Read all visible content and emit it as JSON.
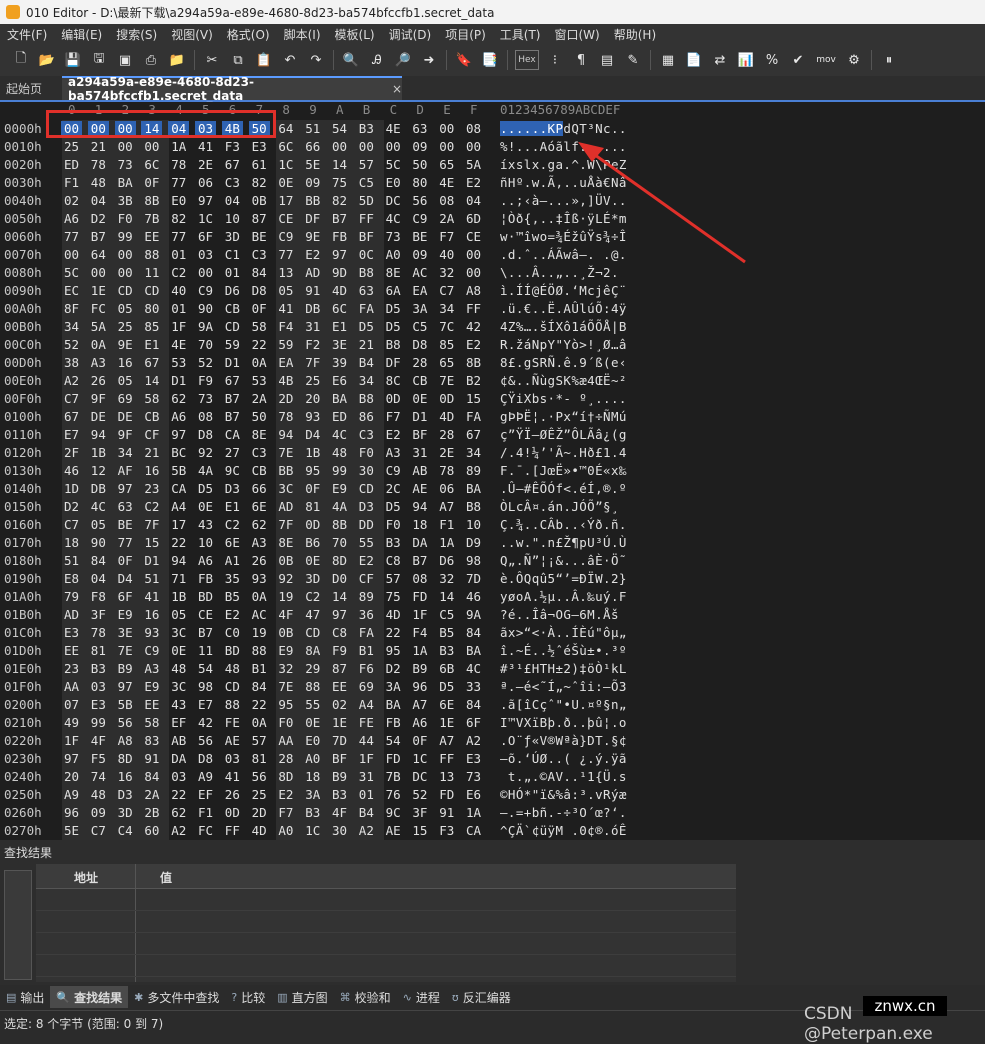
{
  "window": {
    "title": "010 Editor - D:\\最新下载\\a294a59a-e89e-4680-8d23-ba574bfccfb1.secret_data"
  },
  "menu": [
    "文件(F)",
    "编辑(E)",
    "搜索(S)",
    "视图(V)",
    "格式(O)",
    "脚本(I)",
    "模板(L)",
    "调试(D)",
    "项目(P)",
    "工具(T)",
    "窗口(W)",
    "帮助(H)"
  ],
  "toolbar": {
    "hex_label": "Hex",
    "mov_label": "mov"
  },
  "tabs": {
    "home": "起始页",
    "file": "a294a59a-e89e-4680-8d23-ba574bfccfb1.secret_data",
    "close": "×"
  },
  "hex": {
    "column_headers": [
      "0",
      "1",
      "2",
      "3",
      "4",
      "5",
      "6",
      "7",
      "8",
      "9",
      "A",
      "B",
      "C",
      "D",
      "E",
      "F"
    ],
    "ascii_header": "0123456789ABCDEF",
    "rows": [
      {
        "addr": "0000h",
        "bytes": "00 00 00 14 04 03 4B 50 64 51 54 B3 4E 63 00 08",
        "ascii": "......KPdQT³Nc.."
      },
      {
        "addr": "0010h",
        "bytes": "25 21 00 00 1A 41 F3 E3 6C 66 00 00 00 09 00 00",
        "ascii": "%!...Aóãlf......"
      },
      {
        "addr": "0020h",
        "bytes": "ED 78 73 6C 78 2E 67 61 1C 5E 14 57 5C 50 65 5A",
        "ascii": "íxslx.ga.^.W\\PeZ"
      },
      {
        "addr": "0030h",
        "bytes": "F1 48 BA 0F 77 06 C3 82 0E 09 75 C5 E0 80 4E E2",
        "ascii": "ñHº.w.Ã‚..uÅà€Nâ"
      },
      {
        "addr": "0040h",
        "bytes": "02 04 3B 8B E0 97 04 0B 17 BB 82 5D DC 56 08 04",
        "ascii": "..;‹à—...»‚]ÜV.."
      },
      {
        "addr": "0050h",
        "bytes": "A6 D2 F0 7B 82 1C 10 87 CE DF B7 FF 4C C9 2A 6D",
        "ascii": "¦Òð{‚..‡Îß·ÿLÉ*m"
      },
      {
        "addr": "0060h",
        "bytes": "77 B7 99 EE 77 6F 3D BE C9 9E FB BF 73 BE F7 CE",
        "ascii": "w·™îwo=¾ÉžûŸs¾÷Î"
      },
      {
        "addr": "0070h",
        "bytes": "00 64 00 88 01 03 C1 C3 77 E2 97 0C A0 09 40 00",
        "ascii": ".d.ˆ..ÁÃwâ—. .@."
      },
      {
        "addr": "0080h",
        "bytes": "5C 00 00 11 C2 00 01 84 13 AD 9D B8 8E AC 32 00",
        "ascii": "\\...Â..„.­.¸Ž¬2."
      },
      {
        "addr": "0090h",
        "bytes": "EC 1E CD CD 40 C9 D6 D8 05 91 4D 63 6A EA C7 A8",
        "ascii": "ì.ÍÍ@ÉÖØ.‘McjêÇ¨"
      },
      {
        "addr": "00A0h",
        "bytes": "8F FC 05 80 01 90 CB 0F 41 DB 6C FA D5 3A 34 FF",
        "ascii": ".ü.€..Ë.AÛlúÕ:4ÿ"
      },
      {
        "addr": "00B0h",
        "bytes": "34 5A 25 85 1F 9A CD 58 F4 31 E1 D5 D5 C5 7C 42",
        "ascii": "4Z%….šÍXô1áÕÕÅ|B"
      },
      {
        "addr": "00C0h",
        "bytes": "52 0A 9E E1 4E 70 59 22 59 F2 3E 21 B8 D8 85 E2",
        "ascii": "R.žáNpY\"Yò>!¸Ø…â"
      },
      {
        "addr": "00D0h",
        "bytes": "38 A3 16 67 53 52 D1 0A EA 7F 39 B4 DF 28 65 8B",
        "ascii": "8£.gSRÑ.ê.9´ß(e‹"
      },
      {
        "addr": "00E0h",
        "bytes": "A2 26 05 14 D1 F9 67 53 4B 25 E6 34 8C CB 7E B2",
        "ascii": "¢&..ÑùgSK%æ4ŒË~²"
      },
      {
        "addr": "00F0h",
        "bytes": "C7 9F 69 58 62 73 B7 2A 2D 20 BA B8 0D 0E 0D 15",
        "ascii": "ÇŸiXbs·*- º¸...."
      },
      {
        "addr": "0100h",
        "bytes": "67 DE DE CB A6 08 B7 50 78 93 ED 86 F7 D1 4D FA",
        "ascii": "gÞÞË¦.·Px“í†÷ÑMú"
      },
      {
        "addr": "0110h",
        "bytes": "E7 94 9F CF 97 D8 CA 8E 94 D4 4C C3 E2 BF 28 67",
        "ascii": "ç”ŸÏ—ØÊŽ”ÔLÃâ¿(g"
      },
      {
        "addr": "0120h",
        "bytes": "2F 1B 34 21 BC 92 27 C3 7E 1B 48 F0 A3 31 2E 34",
        "ascii": "/.4!¼’'Ã~.Hð£1.4"
      },
      {
        "addr": "0130h",
        "bytes": "46 12 AF 16 5B 4A 9C CB BB 95 99 30 C9 AB 78 89",
        "ascii": "F.¯.[JœË»•™0É«x‰"
      },
      {
        "addr": "0140h",
        "bytes": "1D DB 97 23 CA D5 D3 66 3C 0F E9 CD 2C AE 06 BA",
        "ascii": ".Û—#ÊÕÓf<.éÍ,®.º"
      },
      {
        "addr": "0150h",
        "bytes": "D2 4C 63 C2 A4 0E E1 6E AD 81 4A D3 D5 94 A7 B8",
        "ascii": "ÒLcÂ¤.án­.JÓÕ”§¸"
      },
      {
        "addr": "0160h",
        "bytes": "C7 05 BE 7F 17 43 C2 62 7F 0D 8B DD F0 18 F1 10",
        "ascii": "Ç.¾..CÂb..‹Ýð.ñ."
      },
      {
        "addr": "0170h",
        "bytes": "18 90 77 15 22 10 6E A3 8E B6 70 55 B3 DA 1A D9",
        "ascii": "..w.\".n£Ž¶pU³Ú.Ù"
      },
      {
        "addr": "0180h",
        "bytes": "51 84 0F D1 94 A6 A1 26 0B 0E 8D E2 C8 B7 D6 98",
        "ascii": "Q„.Ñ”¦¡&...âÈ·Ö˜"
      },
      {
        "addr": "0190h",
        "bytes": "E8 04 D4 51 71 FB 35 93 92 3D D0 CF 57 08 32 7D",
        "ascii": "è.ÔQqû5“’=ÐÏW.2}"
      },
      {
        "addr": "01A0h",
        "bytes": "79 F8 6F 41 1B BD B5 0A 19 C2 14 89 75 FD 14 46",
        "ascii": "yøoA.½µ..Â.‰uý.F"
      },
      {
        "addr": "01B0h",
        "bytes": "AD 3F E9 16 05 CE E2 AC 4F 47 97 36 4D 1F C5 9A",
        "ascii": "­?é..Îâ¬OG—6M.Åš"
      },
      {
        "addr": "01C0h",
        "bytes": "E3 78 3E 93 3C B7 C0 19 0B CD C8 FA 22 F4 B5 84",
        "ascii": "ãx>“<·À..ÍÈú\"ôµ„"
      },
      {
        "addr": "01D0h",
        "bytes": "EE 81 7E C9 0E 11 BD 88 E9 8A F9 B1 95 1A B3 BA",
        "ascii": "î.~É..½ˆéŠù±•.³º"
      },
      {
        "addr": "01E0h",
        "bytes": "23 B3 B9 A3 48 54 48 B1 32 29 87 F6 D2 B9 6B 4C",
        "ascii": "#³¹£HTH±2)‡öÒ¹kL"
      },
      {
        "addr": "01F0h",
        "bytes": "AA 03 97 E9 3C 98 CD 84 7E 88 EE 69 3A 96 D5 33",
        "ascii": "ª.—é<˜Í„~ˆîi:–Õ3"
      },
      {
        "addr": "0200h",
        "bytes": "07 E3 5B EE 43 E7 88 22 95 55 02 A4 BA A7 6E 84",
        "ascii": ".ã[îCçˆ\"•U.¤º§n„"
      },
      {
        "addr": "0210h",
        "bytes": "49 99 56 58 EF 42 FE 0A F0 0E 1E FE FB A6 1E 6F",
        "ascii": "I™VXïBþ.ð..þû¦.o"
      },
      {
        "addr": "0220h",
        "bytes": "1F 4F A8 83 AB 56 AE 57 AA E0 7D 44 54 0F A7 A2",
        "ascii": ".O¨ƒ«V®Wªà}DT.§¢"
      },
      {
        "addr": "0230h",
        "bytes": "97 F5 8D 91 DA D8 03 81 28 A0 BF 1F FD 1C FF E3",
        "ascii": "—õ.‘ÚØ..( ¿.ý.ÿã"
      },
      {
        "addr": "0240h",
        "bytes": "20 74 16 84 03 A9 41 56 8D 18 B9 31 7B DC 13 73",
        "ascii": " t.„.©AV..¹1{Ü.s"
      },
      {
        "addr": "0250h",
        "bytes": "A9 48 D3 2A 22 EF 26 25 E2 3A B3 01 76 52 FD E6",
        "ascii": "©HÓ*\"ï&%â:³.vRýæ"
      },
      {
        "addr": "0260h",
        "bytes": "96 09 3D 2B 62 F1 0D 2D F7 B3 4F B4 9C 3F 91 1A",
        "ascii": "–.=+bñ.-÷³O´œ?‘."
      },
      {
        "addr": "0270h",
        "bytes": "5E C7 C4 60 A2 FC FF 4D A0 1C 30 A2 AE 15 F3 CA",
        "ascii": "^ÇÄ`¢üÿM .0¢®.óÊ"
      }
    ]
  },
  "find_panel": {
    "title": "查找结果",
    "col_address": "地址",
    "col_value": "值"
  },
  "bottom_tabs": [
    "输出",
    "查找结果",
    "多文件中查找",
    "比较",
    "直方图",
    "校验和",
    "进程",
    "反汇编器"
  ],
  "status": {
    "text": "选定: 8 个字节 (范围: 0 到 7)"
  },
  "watermark": {
    "csdn": "CSDN @Peterpan.exe",
    "site": "znwx.cn"
  },
  "colors": {
    "selection": "#2f63b3",
    "highlight_box": "#e0302a",
    "arrow": "#e0302a"
  }
}
